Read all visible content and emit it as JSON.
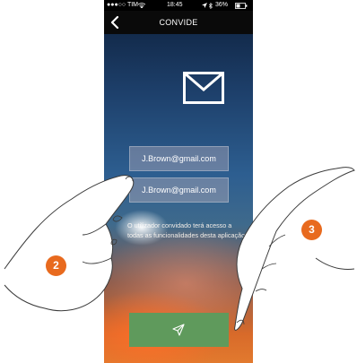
{
  "status_bar": {
    "carrier": "●●●○○ TIM",
    "wifi_icon": "wifi-icon",
    "time": "18:45",
    "battery": "36%"
  },
  "nav": {
    "title": "CONVIDE",
    "back_icon": "chevron-left-icon"
  },
  "header_icon": "envelope-icon",
  "form": {
    "email_1": "J.Brown@gmail.com",
    "email_2": "J.Brown@gmail.com",
    "info_text": "O utilizador convidado terá acesso a todas as funcionalidades desta aplicação",
    "send_icon": "send-icon"
  },
  "annotations": {
    "step_2": "2",
    "step_3": "3"
  },
  "colors": {
    "send_button": "#5f9a5c",
    "step_badge": "#e86a1e",
    "nav_bar": "#0a0a0a"
  }
}
